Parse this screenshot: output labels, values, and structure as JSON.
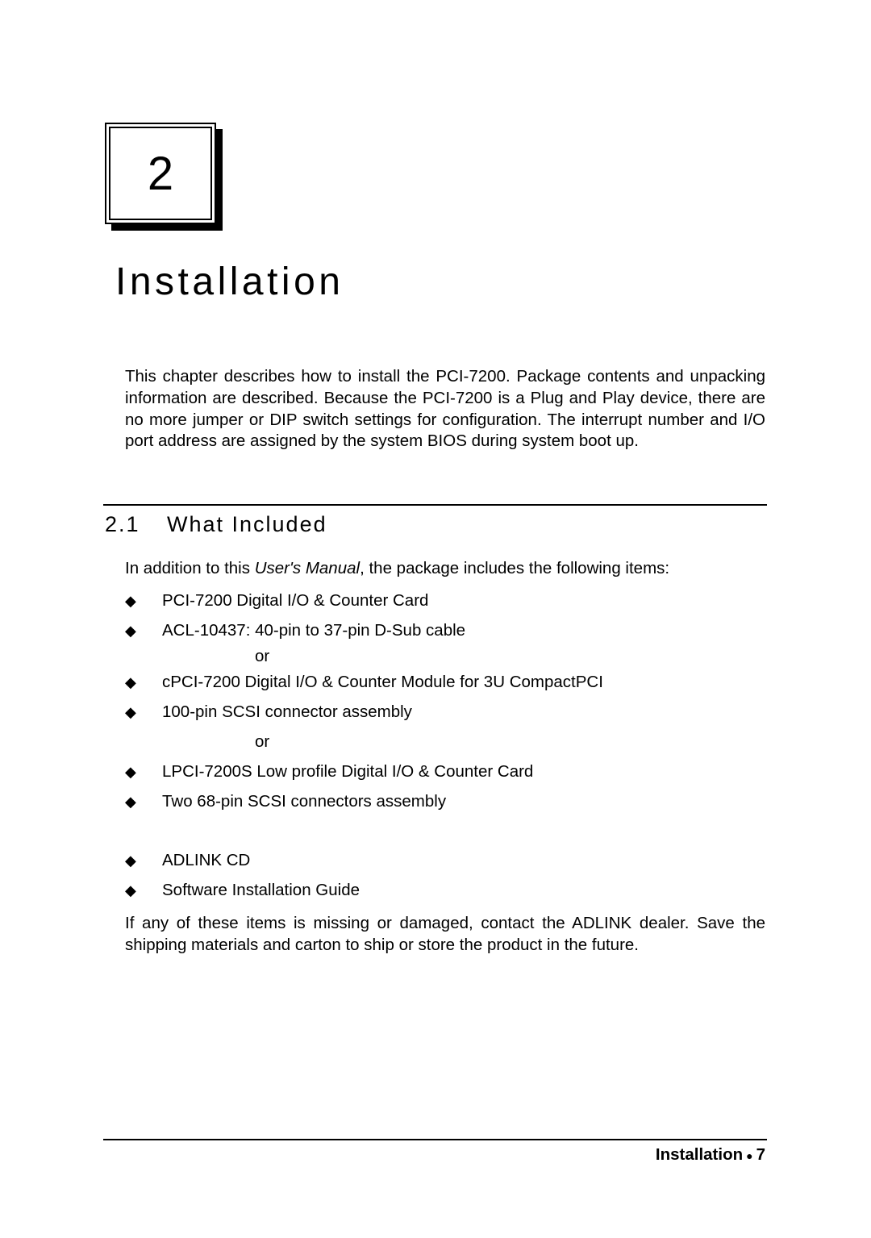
{
  "chapter": {
    "number": "2",
    "title": "Installation",
    "intro": "This chapter describes how to install the PCI-7200.  Package contents and unpacking information are described. Because the PCI-7200 is a Plug and Play device, there are no more jumper or DIP switch settings for configuration. The interrupt number and I/O port address are assigned by the system BIOS during system boot up."
  },
  "section": {
    "number": "2.1",
    "title": "What Included",
    "intro_pre": "In addition to this ",
    "intro_italic": "User's Manual",
    "intro_post": ", the package includes the following items:",
    "bullet_icon": "diamond-bullet-icon",
    "or_label": "or",
    "items": [
      "PCI-7200 Digital I/O & Counter Card",
      "ACL-10437: 40-pin to 37-pin D-Sub cable",
      "cPCI-7200 Digital I/O & Counter Module for 3U CompactPCI",
      "100-pin SCSI connector assembly",
      "LPCI-7200S Low profile Digital I/O & Counter Card",
      "Two 68-pin SCSI connectors assembly",
      "ADLINK CD",
      "Software Installation Guide"
    ],
    "closing": "If any of these items is missing or damaged, contact the ADLINK dealer. Save the shipping materials and carton to ship or store the product in the future."
  },
  "footer": {
    "label": "Installation",
    "separator_icon": "bullet-dot-icon",
    "page_number": "7"
  }
}
